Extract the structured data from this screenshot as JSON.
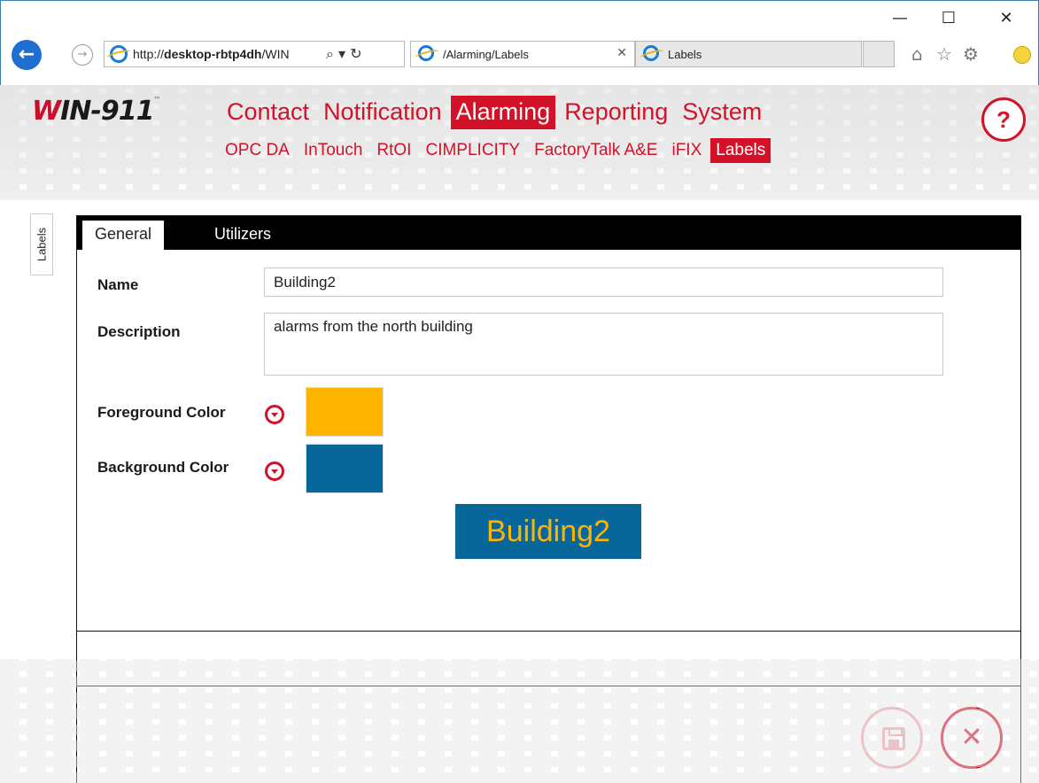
{
  "window": {
    "minimize_glyph": "—",
    "maximize_glyph": "☐",
    "close_glyph": "✕"
  },
  "browser": {
    "address_prefix": "http://",
    "address_host": "desktop-rbtp4dh",
    "address_suffix": "/WIN",
    "address_tools": "⌕ ▾ ↻",
    "tabs": [
      {
        "label": "/Alarming/Labels",
        "close": "✕"
      },
      {
        "label": "Labels"
      }
    ],
    "toolbar_icons": [
      "home-icon",
      "favorites-icon",
      "settings-icon",
      "smiley-icon"
    ],
    "toolbar_glyphs": {
      "home": "⌂",
      "star": "☆",
      "gear": "⚙"
    }
  },
  "app": {
    "logo": {
      "w": "W",
      "rest": "IN-911",
      "tm": "™"
    },
    "main_nav": [
      {
        "label": "Contact",
        "active": false
      },
      {
        "label": "Notification",
        "active": false
      },
      {
        "label": "Alarming",
        "active": true
      },
      {
        "label": "Reporting",
        "active": false
      },
      {
        "label": "System",
        "active": false
      }
    ],
    "sub_nav": [
      {
        "label": "OPC DA",
        "active": false
      },
      {
        "label": "InTouch",
        "active": false
      },
      {
        "label": "RtOI",
        "active": false
      },
      {
        "label": "CIMPLICITY",
        "active": false
      },
      {
        "label": "FactoryTalk A&E",
        "active": false
      },
      {
        "label": "iFIX",
        "active": false
      },
      {
        "label": "Labels",
        "active": true
      }
    ],
    "help_label": "?",
    "side_tab": "Labels",
    "accent_color": "#d3122a"
  },
  "panel": {
    "tabs": [
      {
        "label": "General",
        "active": true
      },
      {
        "label": "Utilizers",
        "active": false
      }
    ],
    "fields": {
      "name_label": "Name",
      "name_value": "Building2",
      "description_label": "Description",
      "description_value": "alarms from the north building",
      "foreground_label": "Foreground Color",
      "foreground_color": "#ffb400",
      "background_label": "Background Color",
      "background_color": "#08679a"
    },
    "preview_text": "Building2",
    "actions": {
      "save_icon": "floppy-disk-icon",
      "cancel_glyph": "✕"
    }
  }
}
